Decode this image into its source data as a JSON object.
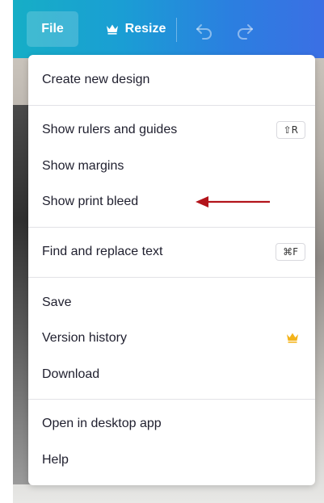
{
  "toolbar": {
    "file_label": "File",
    "resize_label": "Resize",
    "icons": [
      "crown-icon",
      "undo-icon",
      "redo-icon"
    ]
  },
  "menu": {
    "create_new_design": "Create new design",
    "show_rulers": {
      "label": "Show rulers and guides",
      "shortcut": "⇧R"
    },
    "show_margins": "Show margins",
    "show_print_bleed": "Show print bleed",
    "find_replace": {
      "label": "Find and replace text",
      "shortcut": "⌘F"
    },
    "save": "Save",
    "version_history": "Version history",
    "download": "Download",
    "open_desktop": "Open in desktop app",
    "help": "Help"
  },
  "colors": {
    "toolbar_gradient_start": "#16aec6",
    "toolbar_gradient_end": "#3b6fe4",
    "crown": "#f3b31b",
    "annotation_arrow": "#b3141b",
    "menu_text": "#1f1f2e"
  }
}
